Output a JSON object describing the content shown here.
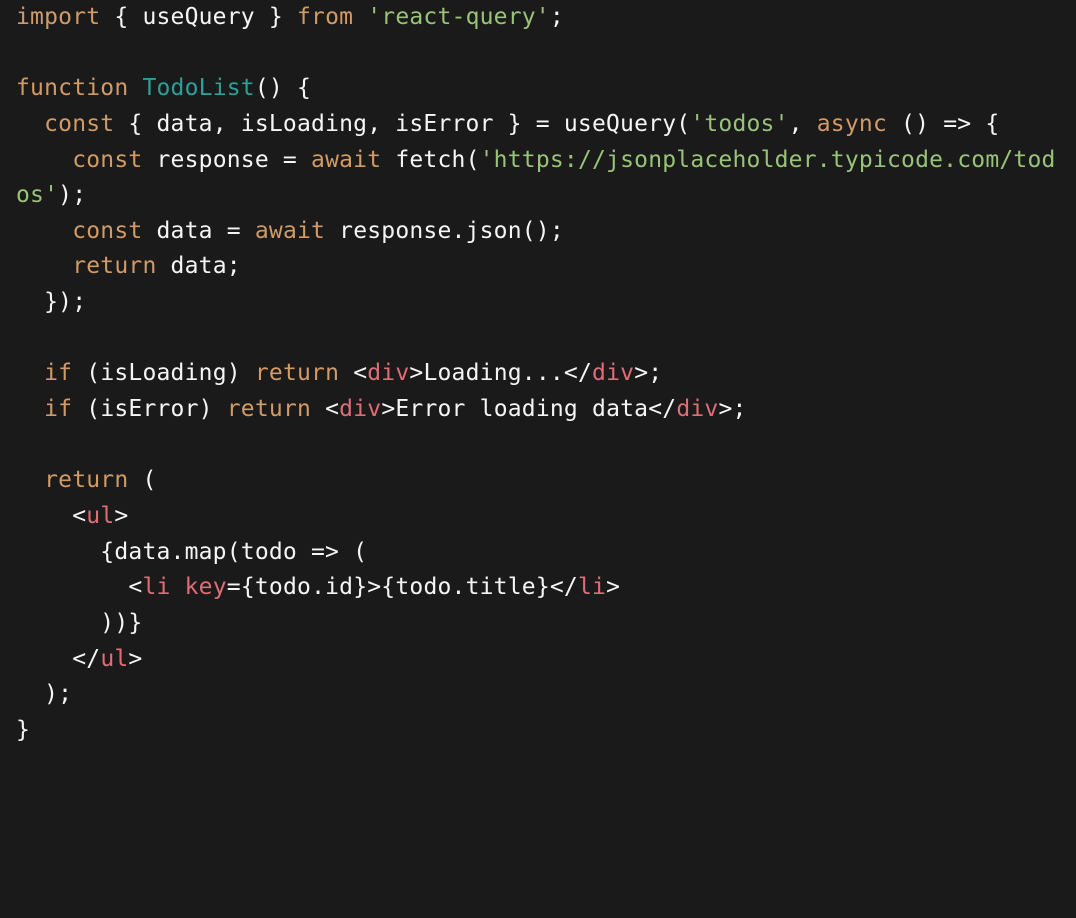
{
  "code": {
    "language": "jsx",
    "tokens": [
      [
        [
          "kw",
          "import"
        ],
        [
          "txt",
          " { useQuery } "
        ],
        [
          "fr",
          "from"
        ],
        [
          "txt",
          " "
        ],
        [
          "str",
          "'react-query'"
        ],
        [
          "txt",
          ";"
        ]
      ],
      [],
      [
        [
          "kw",
          "function"
        ],
        [
          "txt",
          " "
        ],
        [
          "fn",
          "TodoList"
        ],
        [
          "txt",
          "() {"
        ]
      ],
      [
        [
          "txt",
          "  "
        ],
        [
          "kw",
          "const"
        ],
        [
          "txt",
          " { data, isLoading, isError } = useQuery("
        ],
        [
          "str",
          "'todos'"
        ],
        [
          "txt",
          ", "
        ],
        [
          "kw",
          "async"
        ],
        [
          "txt",
          " () => {"
        ]
      ],
      [
        [
          "txt",
          "    "
        ],
        [
          "kw",
          "const"
        ],
        [
          "txt",
          " response = "
        ],
        [
          "kw",
          "await"
        ],
        [
          "txt",
          " fetch("
        ],
        [
          "str",
          "'https://jsonplaceholder.typicode.com/todos'"
        ],
        [
          "txt",
          ");"
        ]
      ],
      [
        [
          "txt",
          "    "
        ],
        [
          "kw",
          "const"
        ],
        [
          "txt",
          " data = "
        ],
        [
          "kw",
          "await"
        ],
        [
          "txt",
          " response.json();"
        ]
      ],
      [
        [
          "txt",
          "    "
        ],
        [
          "kw",
          "return"
        ],
        [
          "txt",
          " data;"
        ]
      ],
      [
        [
          "txt",
          "  });"
        ]
      ],
      [],
      [
        [
          "txt",
          "  "
        ],
        [
          "kw",
          "if"
        ],
        [
          "txt",
          " (isLoading) "
        ],
        [
          "kw",
          "return"
        ],
        [
          "txt",
          " <"
        ],
        [
          "tag",
          "div"
        ],
        [
          "txt",
          ">Loading...</"
        ],
        [
          "tag",
          "div"
        ],
        [
          "txt",
          ">;"
        ]
      ],
      [
        [
          "txt",
          "  "
        ],
        [
          "kw",
          "if"
        ],
        [
          "txt",
          " (isError) "
        ],
        [
          "kw",
          "return"
        ],
        [
          "txt",
          " <"
        ],
        [
          "tag",
          "div"
        ],
        [
          "txt",
          ">Error loading data</"
        ],
        [
          "tag",
          "div"
        ],
        [
          "txt",
          ">;"
        ]
      ],
      [],
      [
        [
          "txt",
          "  "
        ],
        [
          "kw",
          "return"
        ],
        [
          "txt",
          " ("
        ]
      ],
      [
        [
          "txt",
          "    <"
        ],
        [
          "tag",
          "ul"
        ],
        [
          "txt",
          ">"
        ]
      ],
      [
        [
          "txt",
          "      {data.map(todo => ("
        ]
      ],
      [
        [
          "txt",
          "        <"
        ],
        [
          "tag",
          "li"
        ],
        [
          "txt",
          " "
        ],
        [
          "tag",
          "key"
        ],
        [
          "txt",
          "={todo.id}>{todo.title}</"
        ],
        [
          "tag",
          "li"
        ],
        [
          "txt",
          ">"
        ]
      ],
      [
        [
          "txt",
          "      ))}"
        ]
      ],
      [
        [
          "txt",
          "    </"
        ],
        [
          "tag",
          "ul"
        ],
        [
          "txt",
          ">"
        ]
      ],
      [
        [
          "txt",
          "  );"
        ]
      ],
      [
        [
          "txt",
          "}"
        ]
      ]
    ]
  }
}
